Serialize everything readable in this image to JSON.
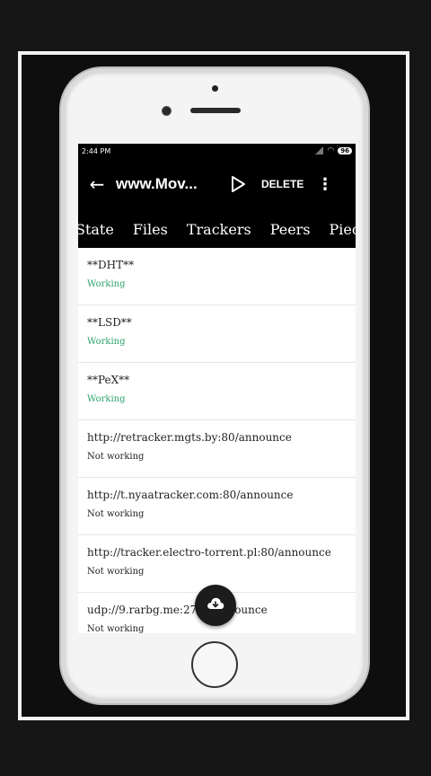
{
  "status_bar": {
    "time": "2:44 PM",
    "battery": "96"
  },
  "app_bar": {
    "title": "www.Mov...",
    "delete_label": "DELETE"
  },
  "tabs": [
    "State",
    "Files",
    "Trackers",
    "Peers",
    "Piece"
  ],
  "trackers": [
    {
      "url": "**DHT**",
      "status": "Working"
    },
    {
      "url": "**LSD**",
      "status": "Working"
    },
    {
      "url": "**PeX**",
      "status": "Working"
    },
    {
      "url": "http://retracker.mgts.by:80/announce",
      "status": "Not working"
    },
    {
      "url": "http://t.nyaatracker.com:80/announce",
      "status": "Not working"
    },
    {
      "url": "http://tracker.electro-torrent.pl:80/announce",
      "status": "Not working"
    },
    {
      "url": "udp://9.rarbg.me:2710/announce",
      "status": "Not working"
    }
  ],
  "colors": {
    "working": "#2ea36c",
    "not_working": "#222222",
    "app_bar": "#000000"
  },
  "icons": {
    "back": "arrow-left-icon",
    "play": "play-icon",
    "more": "more-vert-icon",
    "fab": "cloud-download-icon"
  }
}
